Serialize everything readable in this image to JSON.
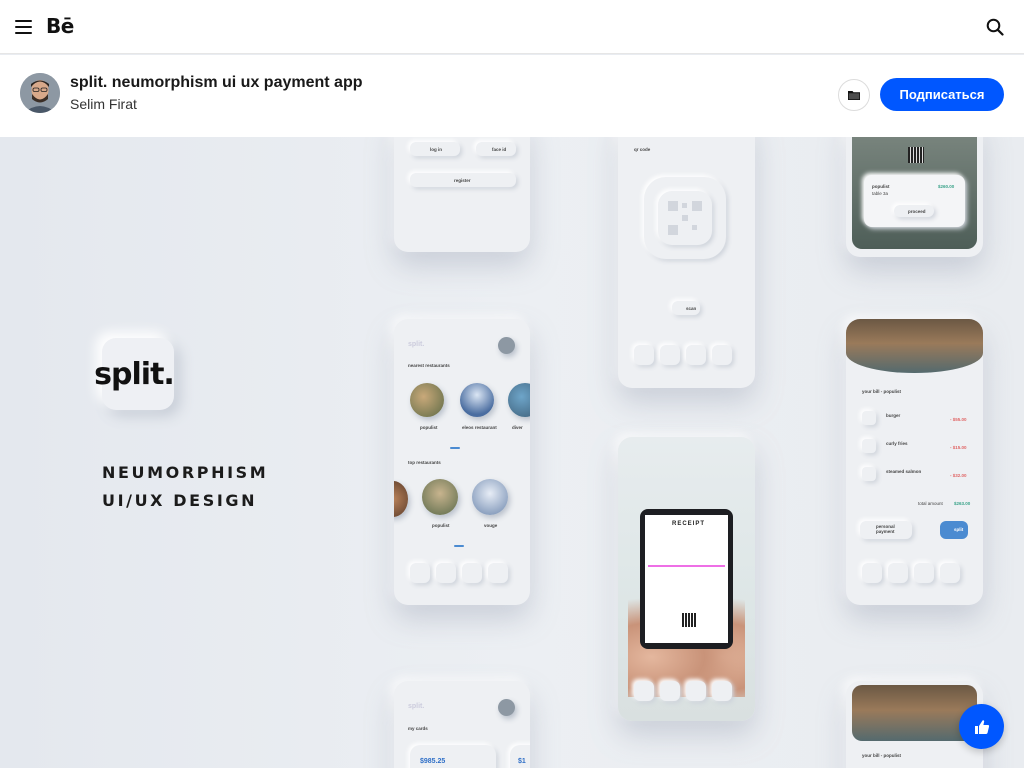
{
  "header": {
    "logo": "Bē"
  },
  "project": {
    "title": "split. neumorphism ui ux payment app",
    "author": "Selim Firat",
    "follow_label": "Подписаться"
  },
  "artwork": {
    "app_icon_text": "split.",
    "tagline_line1": "NEUMORPHISM",
    "tagline_line2": "UI/UX DESIGN",
    "login": {
      "log_in": "log in",
      "face_id": "face id",
      "register": "register"
    },
    "qr": {
      "title": "qr code",
      "scan": "scan"
    },
    "table_card": {
      "name": "populist",
      "table": "table 3a",
      "amount": "$260.00",
      "proceed": "proceed"
    },
    "nearest": {
      "brand": "split.",
      "nearest_title": "nearest restaurants",
      "top_title": "top restaurants",
      "places_a": [
        "populist",
        "eleos restaurant",
        "diver"
      ],
      "places_b": [
        "populist",
        "vouge"
      ]
    },
    "receipt": {
      "title": "RECEIPT"
    },
    "bill": {
      "title": "your bill - populist",
      "items": [
        {
          "name": "burger",
          "price": "- $55.00"
        },
        {
          "name": "curly fries",
          "price": "- $15.00"
        },
        {
          "name": "steamed salmon",
          "price": "- $32.00"
        }
      ],
      "total_label": "total amount",
      "total": "$263.00",
      "personal": "personal payment",
      "split": "split"
    },
    "cards": {
      "brand": "split.",
      "title": "my cards",
      "amount": "$985.25",
      "amount2": "$1"
    },
    "bill2": {
      "title": "your bill - populist"
    }
  },
  "colors": {
    "accent": "#0057ff",
    "canvas": "#e9ecf1",
    "teal": "#3ba38a",
    "red": "#e06666"
  },
  "icons": [
    "menu-icon",
    "search-icon",
    "folder-icon",
    "thumbs-up-icon"
  ]
}
